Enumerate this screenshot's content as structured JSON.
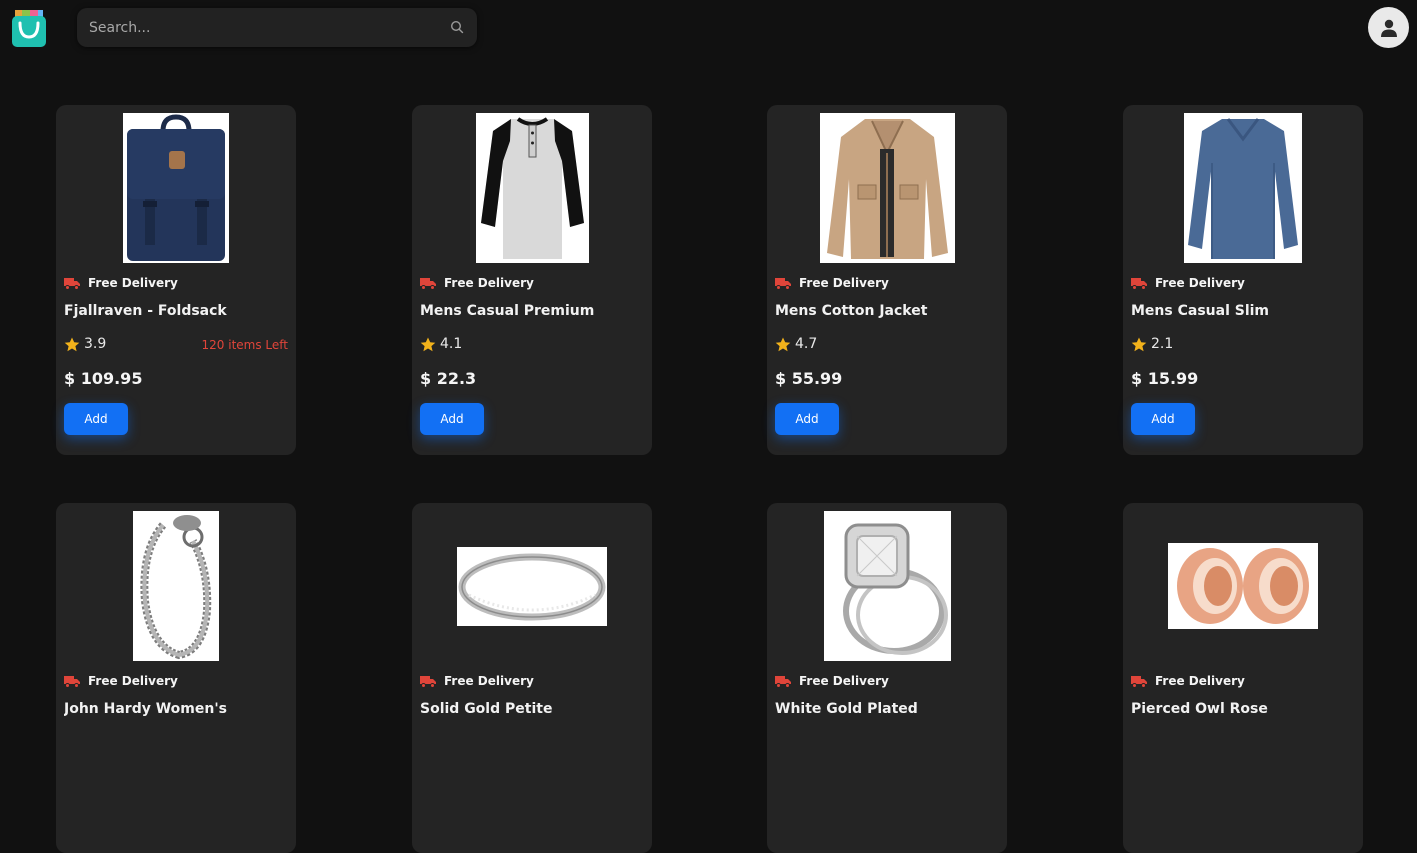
{
  "header": {
    "search_placeholder": "Search...",
    "logo_icon": "shopping-bag-icon",
    "avatar_icon": "user-icon"
  },
  "colors": {
    "background": "#111111",
    "card": "#242424",
    "accent": "#1270f4",
    "stock_warning": "#e0453a",
    "star": "#f2b21b",
    "truck": "#e0453a"
  },
  "products": [
    {
      "delivery": "Free Delivery",
      "title": "Fjallraven - Foldsack",
      "rating": "3.9",
      "stock": "120 items Left",
      "price": "$ 109.95",
      "add_label": "Add",
      "image": "backpack"
    },
    {
      "delivery": "Free Delivery",
      "title": "Mens Casual Premium",
      "rating": "4.1",
      "stock": "",
      "price": "$ 22.3",
      "add_label": "Add",
      "image": "raglan-shirt"
    },
    {
      "delivery": "Free Delivery",
      "title": "Mens Cotton Jacket",
      "rating": "4.7",
      "stock": "",
      "price": "$ 55.99",
      "add_label": "Add",
      "image": "jacket"
    },
    {
      "delivery": "Free Delivery",
      "title": "Mens Casual Slim",
      "rating": "2.1",
      "stock": "",
      "price": "$ 15.99",
      "add_label": "Add",
      "image": "long-sleeve-shirt"
    },
    {
      "delivery": "Free Delivery",
      "title": "John Hardy Women's",
      "rating": "",
      "stock": "",
      "price": "",
      "add_label": "",
      "image": "bracelet"
    },
    {
      "delivery": "Free Delivery",
      "title": "Solid Gold Petite",
      "rating": "",
      "stock": "",
      "price": "",
      "add_label": "",
      "image": "ring"
    },
    {
      "delivery": "Free Delivery",
      "title": "White Gold Plated",
      "rating": "",
      "stock": "",
      "price": "",
      "add_label": "",
      "image": "diamond-ring"
    },
    {
      "delivery": "Free Delivery",
      "title": "Pierced Owl Rose",
      "rating": "",
      "stock": "",
      "price": "",
      "add_label": "",
      "image": "ear-plugs"
    }
  ]
}
